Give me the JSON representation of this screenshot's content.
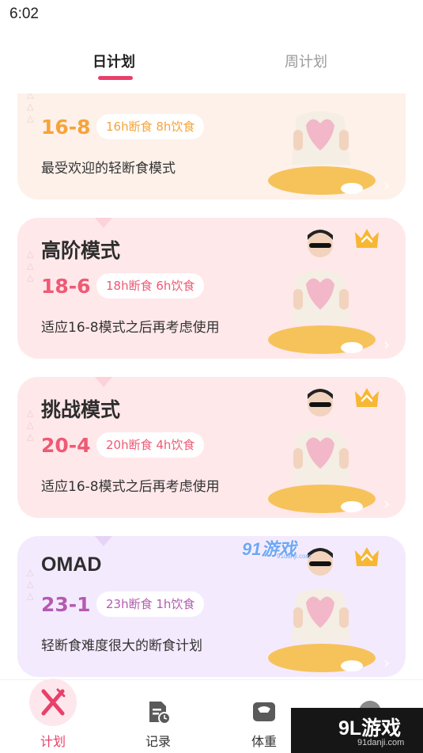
{
  "status_bar": {
    "time": "6:02"
  },
  "tabs": [
    {
      "label": "日计划",
      "active": true
    },
    {
      "label": "周计划",
      "active": false
    }
  ],
  "plans": [
    {
      "title": "",
      "ratio": "16-8",
      "pill": "16h断食 8h饮食",
      "desc": "最受欢迎的轻断食模式",
      "premium": false,
      "accent": "#f7a33a"
    },
    {
      "title": "高阶模式",
      "ratio": "18-6",
      "pill": "18h断食 6h饮食",
      "desc": "适应16-8模式之后再考虑使用",
      "premium": true,
      "accent": "#ee5a74"
    },
    {
      "title": "挑战模式",
      "ratio": "20-4",
      "pill": "20h断食 4h饮食",
      "desc": "适应16-8模式之后再考虑使用",
      "premium": true,
      "accent": "#ee5a74"
    },
    {
      "title": "OMAD",
      "ratio": "23-1",
      "pill": "23h断食 1h饮食",
      "desc": "轻断食难度很大的断食计划",
      "premium": true,
      "accent": "#b35bb0"
    }
  ],
  "watermark_mid": {
    "logo": "91游戏",
    "site": "91danji.com"
  },
  "bottom_nav": [
    {
      "label": "计划",
      "icon": "fork-knife-icon",
      "active": true
    },
    {
      "label": "记录",
      "icon": "record-clock-icon",
      "active": false
    },
    {
      "label": "体重",
      "icon": "scale-icon",
      "active": false
    },
    {
      "label": "",
      "icon": "profile-icon",
      "active": false
    }
  ],
  "watermark_corner": {
    "logo": "9L游戏",
    "site": "91danji.com"
  },
  "colors": {
    "accent": "#e8406a",
    "orange": "#f7a33a",
    "pink": "#ee5a74",
    "purple": "#b35bb0"
  }
}
